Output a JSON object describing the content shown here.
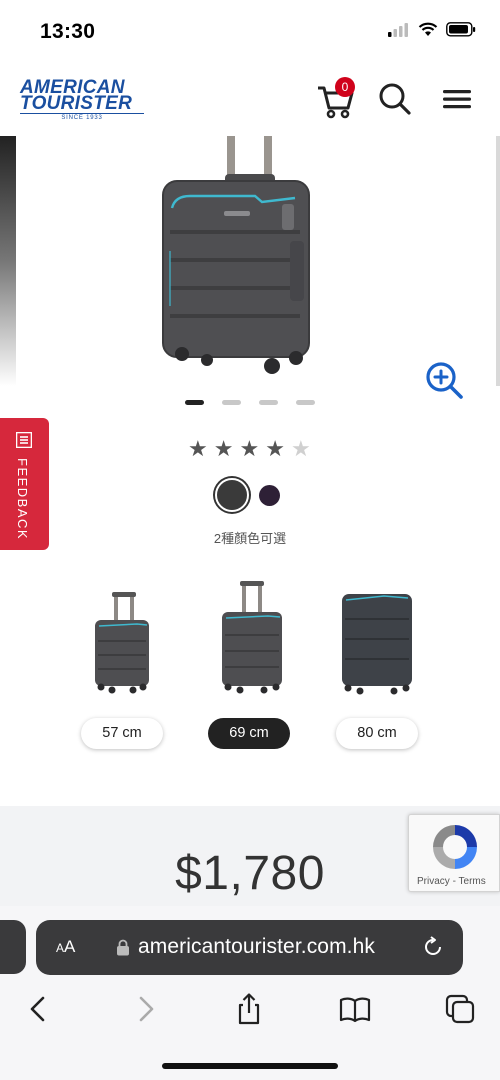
{
  "status": {
    "time": "13:30"
  },
  "header": {
    "logo_line1": "AMERICAN",
    "logo_line2": "TOURISTER",
    "logo_since": "SINCE 1933",
    "cart_count": "0",
    "brand_color": "#1a4fa0",
    "badge_color": "#d0021b"
  },
  "feedback": {
    "label": "FEEDBACK",
    "color": "#d6283c"
  },
  "gallery": {
    "image_count": 4,
    "active_index": 0
  },
  "product": {
    "rating": 4,
    "rating_max": 5,
    "colors_text": "2種顏色可選",
    "swatch_colors": [
      "#3a3a3a",
      "#2e2036"
    ],
    "sizes": [
      {
        "label": "57 cm",
        "selected": false
      },
      {
        "label": "69 cm",
        "selected": true
      },
      {
        "label": "80 cm",
        "selected": false
      }
    ],
    "price": "$1,780"
  },
  "recaptcha": {
    "privacy": "Privacy",
    "separator": " - ",
    "terms": "Terms"
  },
  "browser": {
    "aa_small": "A",
    "aa_large": "A",
    "url": "americantourister.com.hk"
  }
}
